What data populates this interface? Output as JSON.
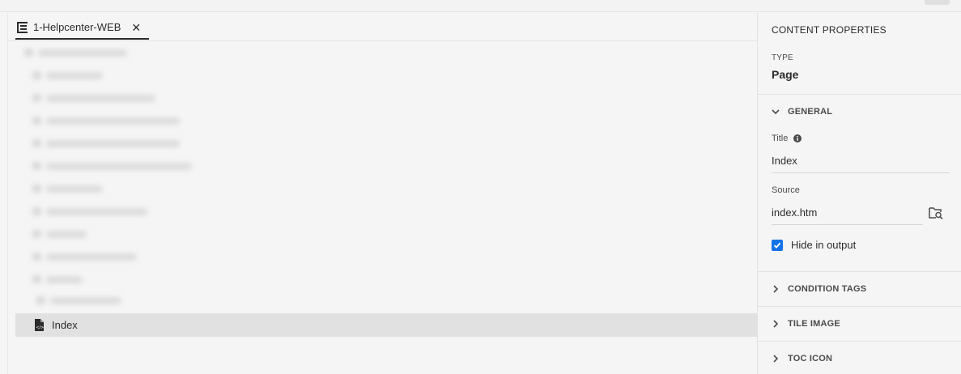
{
  "editor": {
    "tab_label": "1-Helpcenter-WEB",
    "tab_close_glyph": "✕",
    "selected_item": "Index"
  },
  "properties": {
    "title": "CONTENT PROPERTIES",
    "type_label": "TYPE",
    "type_value": "Page",
    "general": {
      "header": "GENERAL",
      "title_label": "Title",
      "title_value": "Index",
      "source_label": "Source",
      "source_value": "index.htm",
      "hide_label": "Hide in output",
      "hide_checked": true
    },
    "sections": {
      "condition_tags": "CONDITION TAGS",
      "tile_image": "TILE IMAGE",
      "toc_icon": "TOC ICON"
    }
  },
  "icons": {
    "tab": "tree-structure-icon",
    "close": "close-icon",
    "selected": "page-icon",
    "info": "info-icon",
    "browse": "browse-folder-icon",
    "expanded": "chevron-down-icon",
    "collapsed": "chevron-right-icon"
  },
  "colors": {
    "accent": "#1473e6",
    "selection": "#e1e1e1",
    "background": "#f5f5f5"
  }
}
